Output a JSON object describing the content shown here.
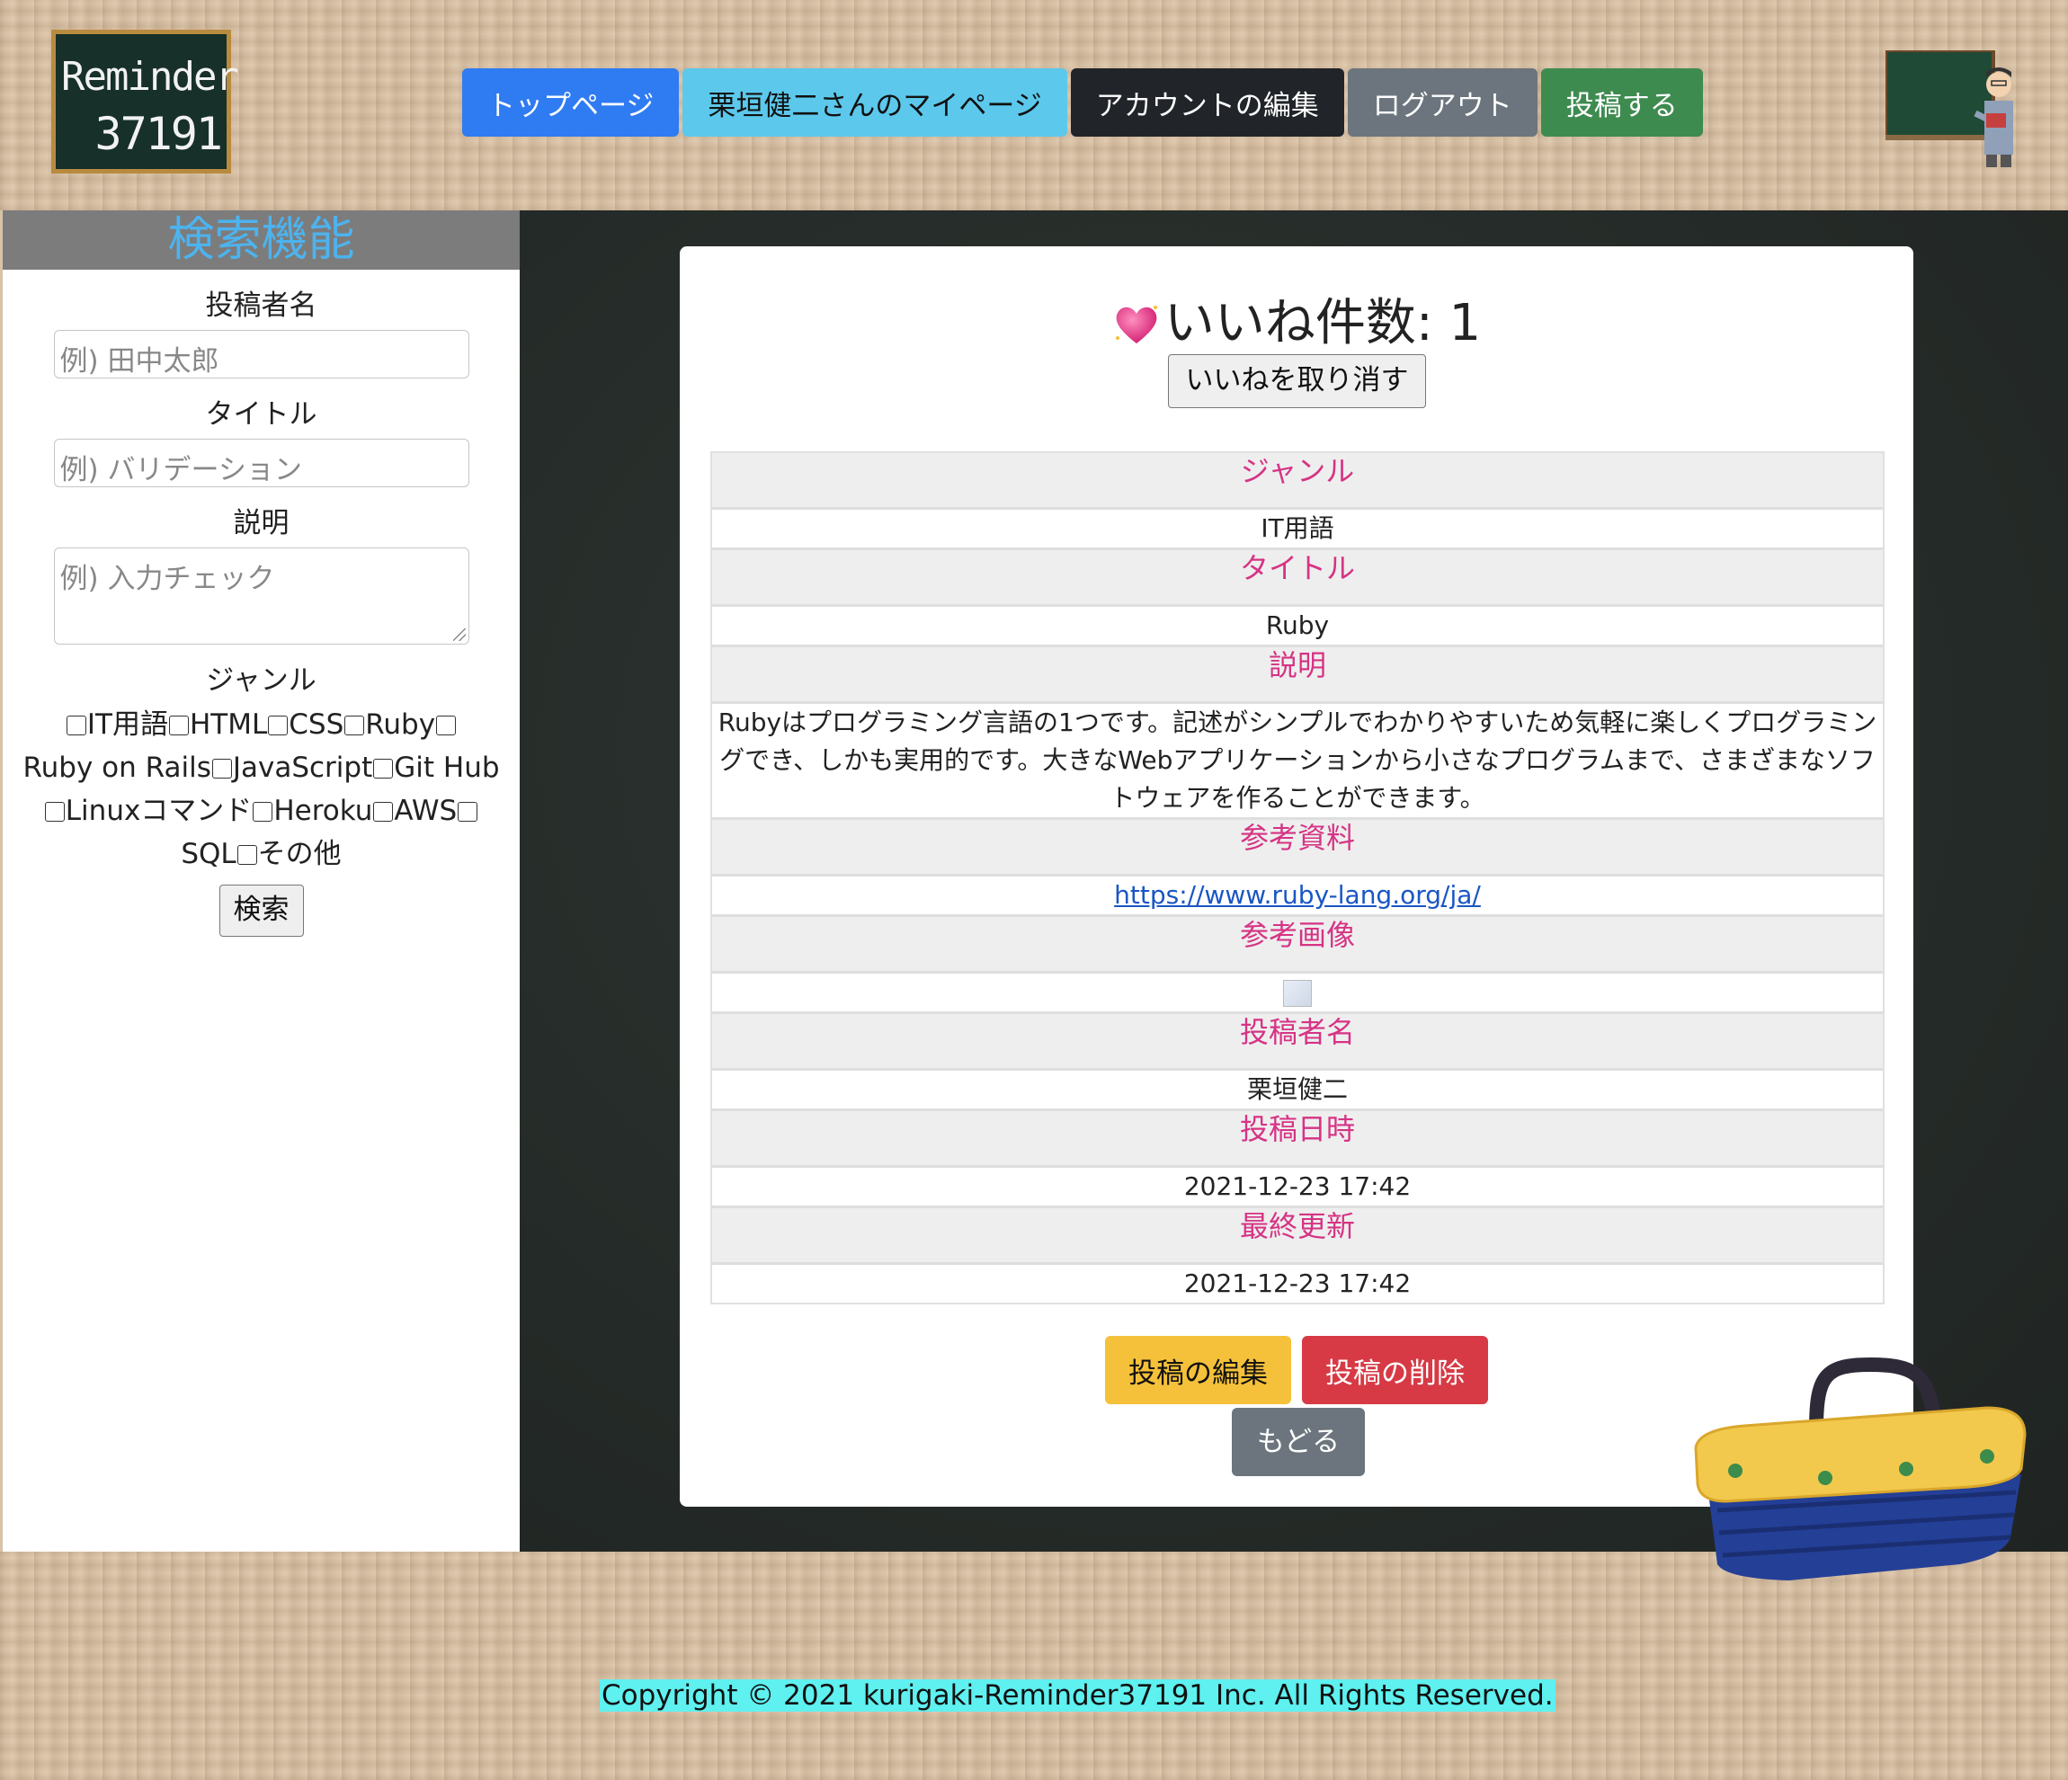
{
  "logo": {
    "line1": "Reminder",
    "line2": "37191"
  },
  "nav": {
    "top": "トップページ",
    "mypage": "栗垣健二さんのマイページ",
    "edit_account": "アカウントの編集",
    "logout": "ログアウト",
    "post": "投稿する"
  },
  "sidebar": {
    "title": "検索機能",
    "author_label": "投稿者名",
    "author_placeholder": "例) 田中太郎",
    "title_label": "タイトル",
    "title_placeholder": "例) バリデーション",
    "desc_label": "説明",
    "desc_placeholder": "例) 入力チェック",
    "genre_label": "ジャンル",
    "genres": [
      "IT用語",
      "HTML",
      "CSS",
      "Ruby",
      "Ruby on Rails",
      "JavaScript",
      "Git Hub",
      "Linuxコマンド",
      "Heroku",
      "AWS",
      "SQL",
      "その他"
    ],
    "search_button": "検索"
  },
  "post": {
    "like_count_label": "いいね件数: 1",
    "unlike_button": "いいねを取り消す",
    "fields": {
      "genre_h": "ジャンル",
      "genre_v": "IT用語",
      "title_h": "タイトル",
      "title_v": "Ruby",
      "desc_h": "説明",
      "desc_v": "Rubyはプログラミング言語の1つです。記述がシンプルでわかりやすいため気軽に楽しくプログラミングでき、しかも実用的です。大きなWebアプリケーションから小さなプログラムまで、さまざまなソフトウェアを作ることができます。",
      "ref_h": "参考資料",
      "ref_v": "https://www.ruby-lang.org/ja/",
      "img_h": "参考画像",
      "author_h": "投稿者名",
      "author_v": "栗垣健二",
      "date_h": "投稿日時",
      "date_v": "2021-12-23 17:42",
      "updated_h": "最終更新",
      "updated_v": "2021-12-23 17:42"
    },
    "edit_button": "投稿の編集",
    "delete_button": "投稿の削除",
    "back_button": "もどる"
  },
  "footer": {
    "copyright": "Copyright © 2021 kurigaki-Reminder37191 Inc. All Rights Reserved."
  },
  "colors": {
    "accent_pink": "#d63384",
    "search_title": "#4db3ee",
    "primary": "#2f7bf2",
    "success": "#3e8b50",
    "danger": "#d73a45",
    "warning": "#f5c13a"
  },
  "icons": {
    "like": "heart-icon",
    "logo": "chalkboard-logo",
    "teacher": "teacher-illustration",
    "basket": "basket-illustration"
  }
}
